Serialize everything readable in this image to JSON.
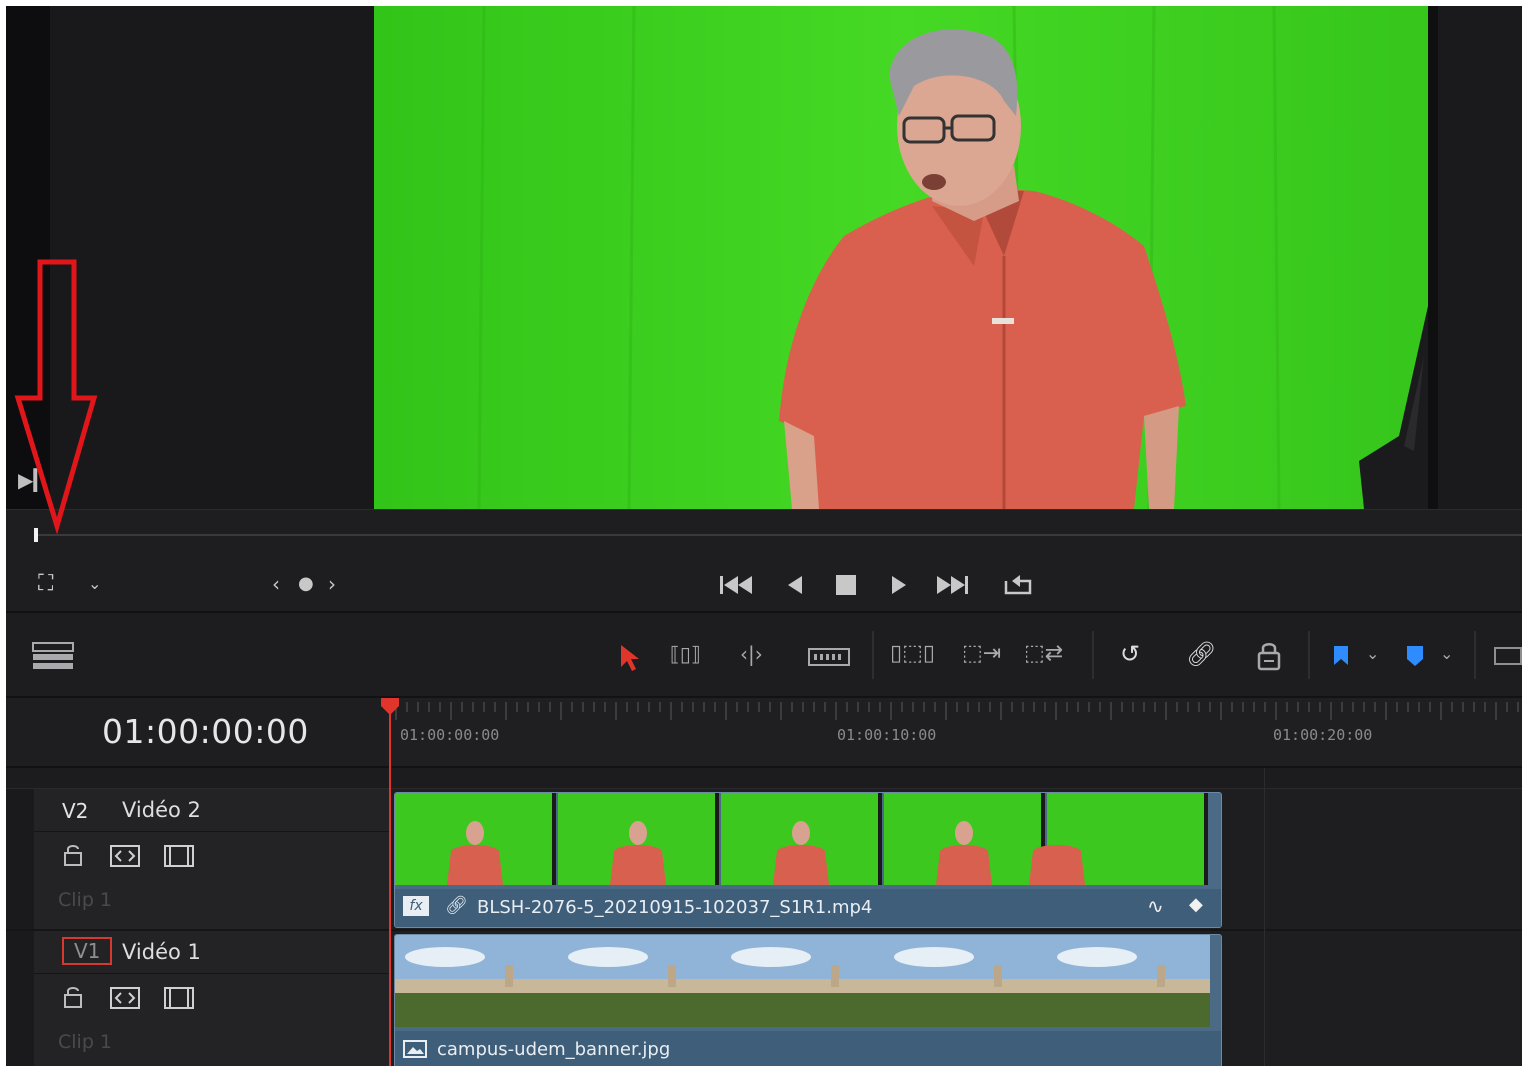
{
  "viewer": {
    "scene": "green screen presenter"
  },
  "transport": {
    "buttons": [
      "skip-to-start",
      "step-back",
      "stop",
      "play",
      "skip-to-end",
      "loop"
    ]
  },
  "timeline": {
    "timecode": "01:00:00:00",
    "ruler_labels": [
      "01:00:00:00",
      "01:00:10:00",
      "01:00:20:00"
    ],
    "tracks": [
      {
        "id": "V2",
        "name": "Vidéo 2",
        "clip_label": "Clip 1",
        "clip_name": "BLSH-2076-5_20210915-102037_S1R1.mp4",
        "clip_badge": "fx"
      },
      {
        "id": "V1",
        "name": "Vidéo 1",
        "clip_label": "Clip 1",
        "clip_name": "campus-udem_banner.jpg"
      }
    ]
  },
  "colors": {
    "accent_red": "#e0352a",
    "clip_blue": "#4a6a85",
    "flag_blue": "#2f8cff"
  }
}
